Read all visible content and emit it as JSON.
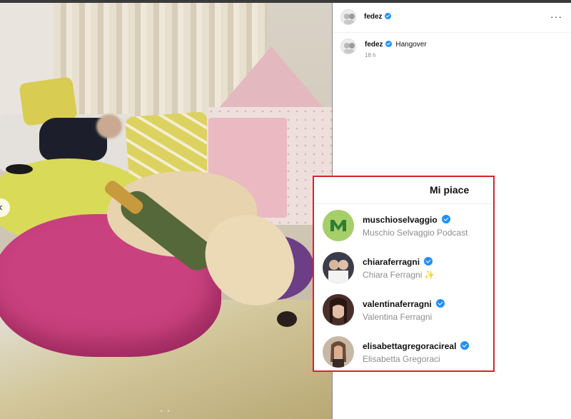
{
  "post": {
    "author": "fedez",
    "caption_user": "fedez",
    "caption_text": "Hangover",
    "timestamp": "18 h",
    "more_glyph": "···",
    "photo_description_icon": "photo-image"
  },
  "carousel": {
    "left_arrow": "‹",
    "right_arrow": "›",
    "dots": "• •"
  },
  "likes_dialog": {
    "title": "Mi piace",
    "users": [
      {
        "username": "muschioselvaggio",
        "full_name": "Muschio Selvaggio Podcast",
        "verified": true,
        "avatar_color": "#a6cf6a"
      },
      {
        "username": "chiaraferragni",
        "full_name": "Chiara Ferragni",
        "verified": true,
        "emoji": "✨",
        "avatar_color": "#3b3d4a"
      },
      {
        "username": "valentinaferragni",
        "full_name": "Valentina Ferragni",
        "verified": true,
        "avatar_color": "#4a2e2a"
      },
      {
        "username": "elisabettagregoracireal",
        "full_name": "Elisabetta Gregoraci",
        "verified": true,
        "avatar_color": "#6b4a3a"
      }
    ]
  },
  "colors": {
    "highlight_border": "#d8232a",
    "verified_blue": "#1e90ff"
  }
}
